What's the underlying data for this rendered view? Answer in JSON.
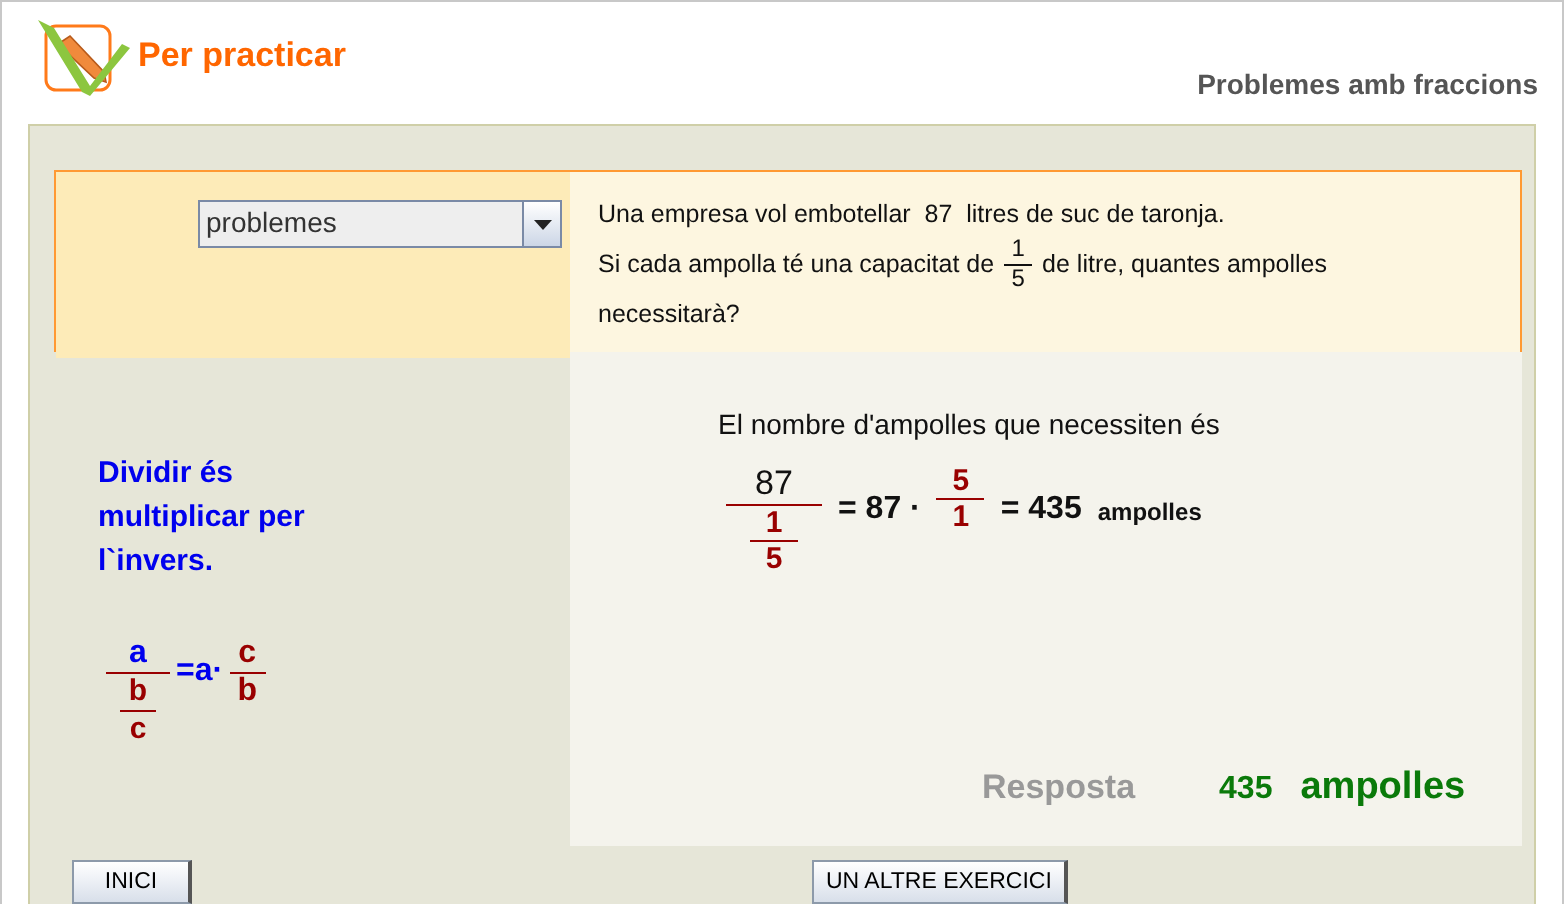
{
  "header": {
    "title": "Per practicar",
    "subtitle": "Problemes amb fraccions"
  },
  "selector": {
    "value": "problemes"
  },
  "problem": {
    "line_1": "Una empresa vol embotellar  87  litres de suc de taronja.",
    "line_2_start": "Si cada ampolla té una capacitat de",
    "fraction": {
      "numerator": "1",
      "denominator": "5"
    },
    "line_2_end": "de litre, quantes ampolles",
    "line_3": "necessitarà?"
  },
  "rule": {
    "text": "Dividir és multiplicar per l`invers.",
    "formula": {
      "numerator": "a",
      "inner_numerator": "b",
      "inner_denominator": "c",
      "equals": "=a·",
      "result_numerator": "c",
      "result_denominator": "b"
    }
  },
  "solution": {
    "intro": "El nombre d'ampolles que necessiten és",
    "numerator": "87",
    "inner_numerator": "1",
    "inner_denominator": "5",
    "step": "= 87 ·",
    "step_numerator": "5",
    "step_denominator": "1",
    "result": "= 435",
    "unit": "ampolles"
  },
  "answer": {
    "label": "Resposta",
    "value": "435",
    "unit": "ampolles"
  },
  "buttons": [
    {
      "label": "INICI"
    },
    {
      "label": "UN ALTRE EXERCICI"
    }
  ]
}
